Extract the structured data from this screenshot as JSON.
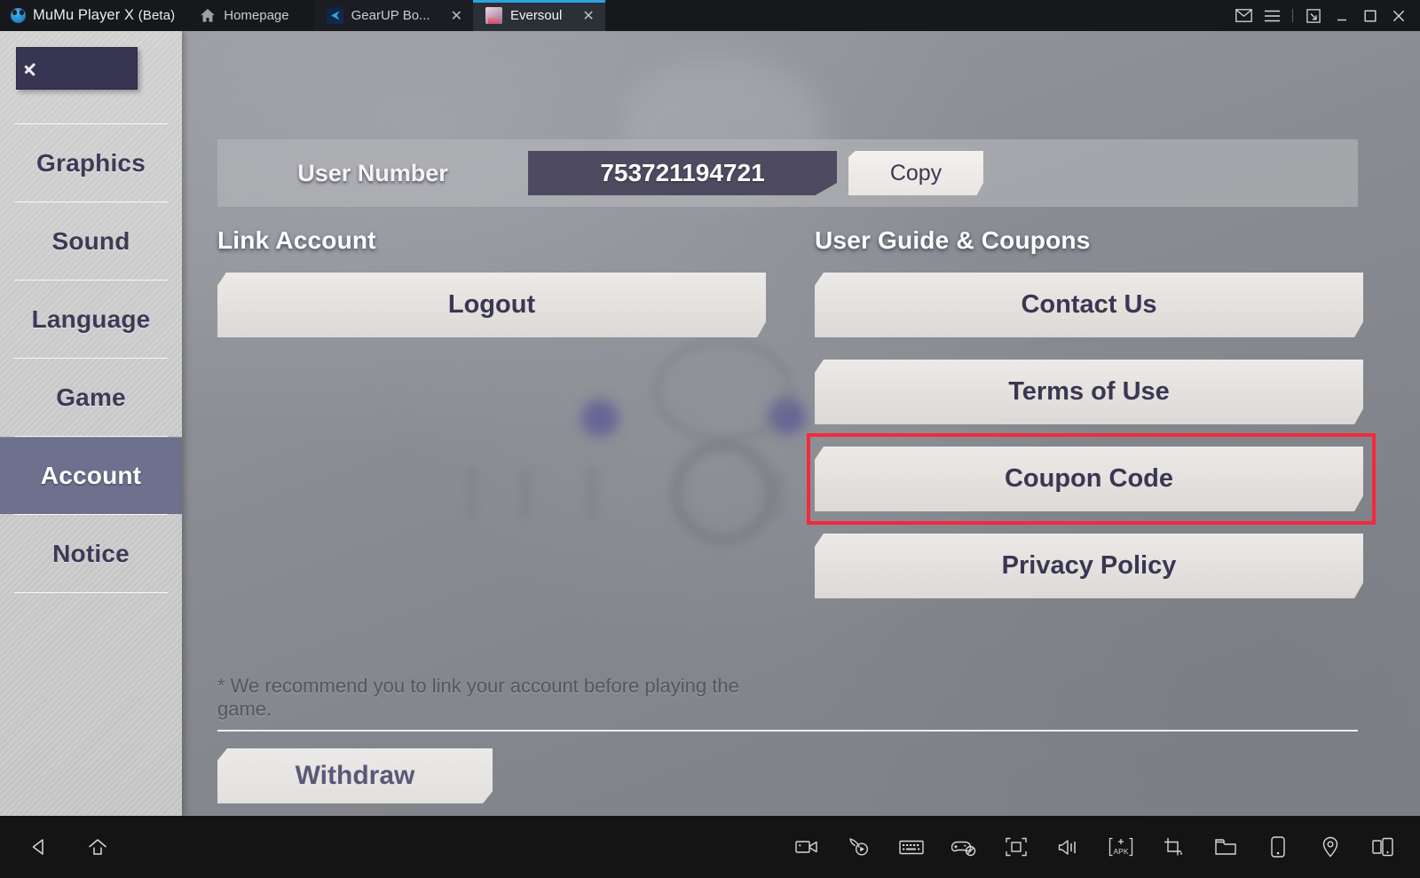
{
  "window": {
    "app_title": "MuMu Player X",
    "app_title_suffix": "(Beta)",
    "controls": [
      {
        "name": "mail-icon",
        "label": "Mail"
      },
      {
        "name": "menu-icon",
        "label": "Menu"
      },
      {
        "name": "restore-icon",
        "label": "Restore"
      },
      {
        "name": "minimize-icon",
        "label": "Minimize"
      },
      {
        "name": "maximize-icon",
        "label": "Maximize"
      },
      {
        "name": "close-icon",
        "label": "Close"
      }
    ]
  },
  "tabs": [
    {
      "label": "Homepage",
      "icon": "home-icon",
      "active": false,
      "closable": false
    },
    {
      "label": "GearUP Bo...",
      "icon": "gearup-icon",
      "active": false,
      "closable": true,
      "close_label": "✕"
    },
    {
      "label": "Eversoul",
      "icon": "eversoul-icon",
      "active": true,
      "closable": true,
      "close_label": "✕"
    }
  ],
  "sidebar": {
    "back_button_label": "Back",
    "items": [
      {
        "label": "Graphics",
        "active": false
      },
      {
        "label": "Sound",
        "active": false
      },
      {
        "label": "Language",
        "active": false
      },
      {
        "label": "Game",
        "active": false
      },
      {
        "label": "Account",
        "active": true
      },
      {
        "label": "Notice",
        "active": false
      }
    ]
  },
  "account": {
    "user_number_label": "User Number",
    "user_number_value": "753721194721",
    "copy_label": "Copy",
    "link_account": {
      "title": "Link Account",
      "buttons": [
        {
          "label": "Logout",
          "highlighted": false
        }
      ]
    },
    "user_guide": {
      "title": "User Guide & Coupons",
      "buttons": [
        {
          "label": "Contact Us",
          "highlighted": false
        },
        {
          "label": "Terms of Use",
          "highlighted": false
        },
        {
          "label": "Coupon Code",
          "highlighted": true
        },
        {
          "label": "Privacy Policy",
          "highlighted": false
        }
      ]
    },
    "note": "* We recommend you to link your account before playing the game.",
    "withdraw_label": "Withdraw"
  },
  "bottom_bar": {
    "left": [
      {
        "name": "android-back-icon",
        "label": "Back"
      },
      {
        "name": "android-home-icon",
        "label": "Home"
      }
    ],
    "right": [
      {
        "name": "record-video-icon",
        "label": "Record screen"
      },
      {
        "name": "macro-play-icon",
        "label": "Macro record"
      },
      {
        "name": "keyboard-icon",
        "label": "Keyboard mapping"
      },
      {
        "name": "gamepad-disabled-icon",
        "label": "Gamepad"
      },
      {
        "name": "fullscreen-icon",
        "label": "Fullscreen"
      },
      {
        "name": "volume-icon",
        "label": "Volume"
      },
      {
        "name": "apk-install-icon",
        "label": "Install APK"
      },
      {
        "name": "crop-screenshot-icon",
        "label": "Screenshot"
      },
      {
        "name": "folder-icon",
        "label": "Shared folder"
      },
      {
        "name": "rotate-screen-icon",
        "label": "Rotate"
      },
      {
        "name": "location-icon",
        "label": "Virtual location"
      },
      {
        "name": "multi-instance-icon",
        "label": "Multi-instance"
      }
    ]
  },
  "colors": {
    "accent_tab": "#2ba4e0",
    "highlight_border": "#f4293c",
    "sidebar_active": "#6e718e",
    "value_chip": "#4e4b60",
    "text_dark": "#3a3752"
  }
}
